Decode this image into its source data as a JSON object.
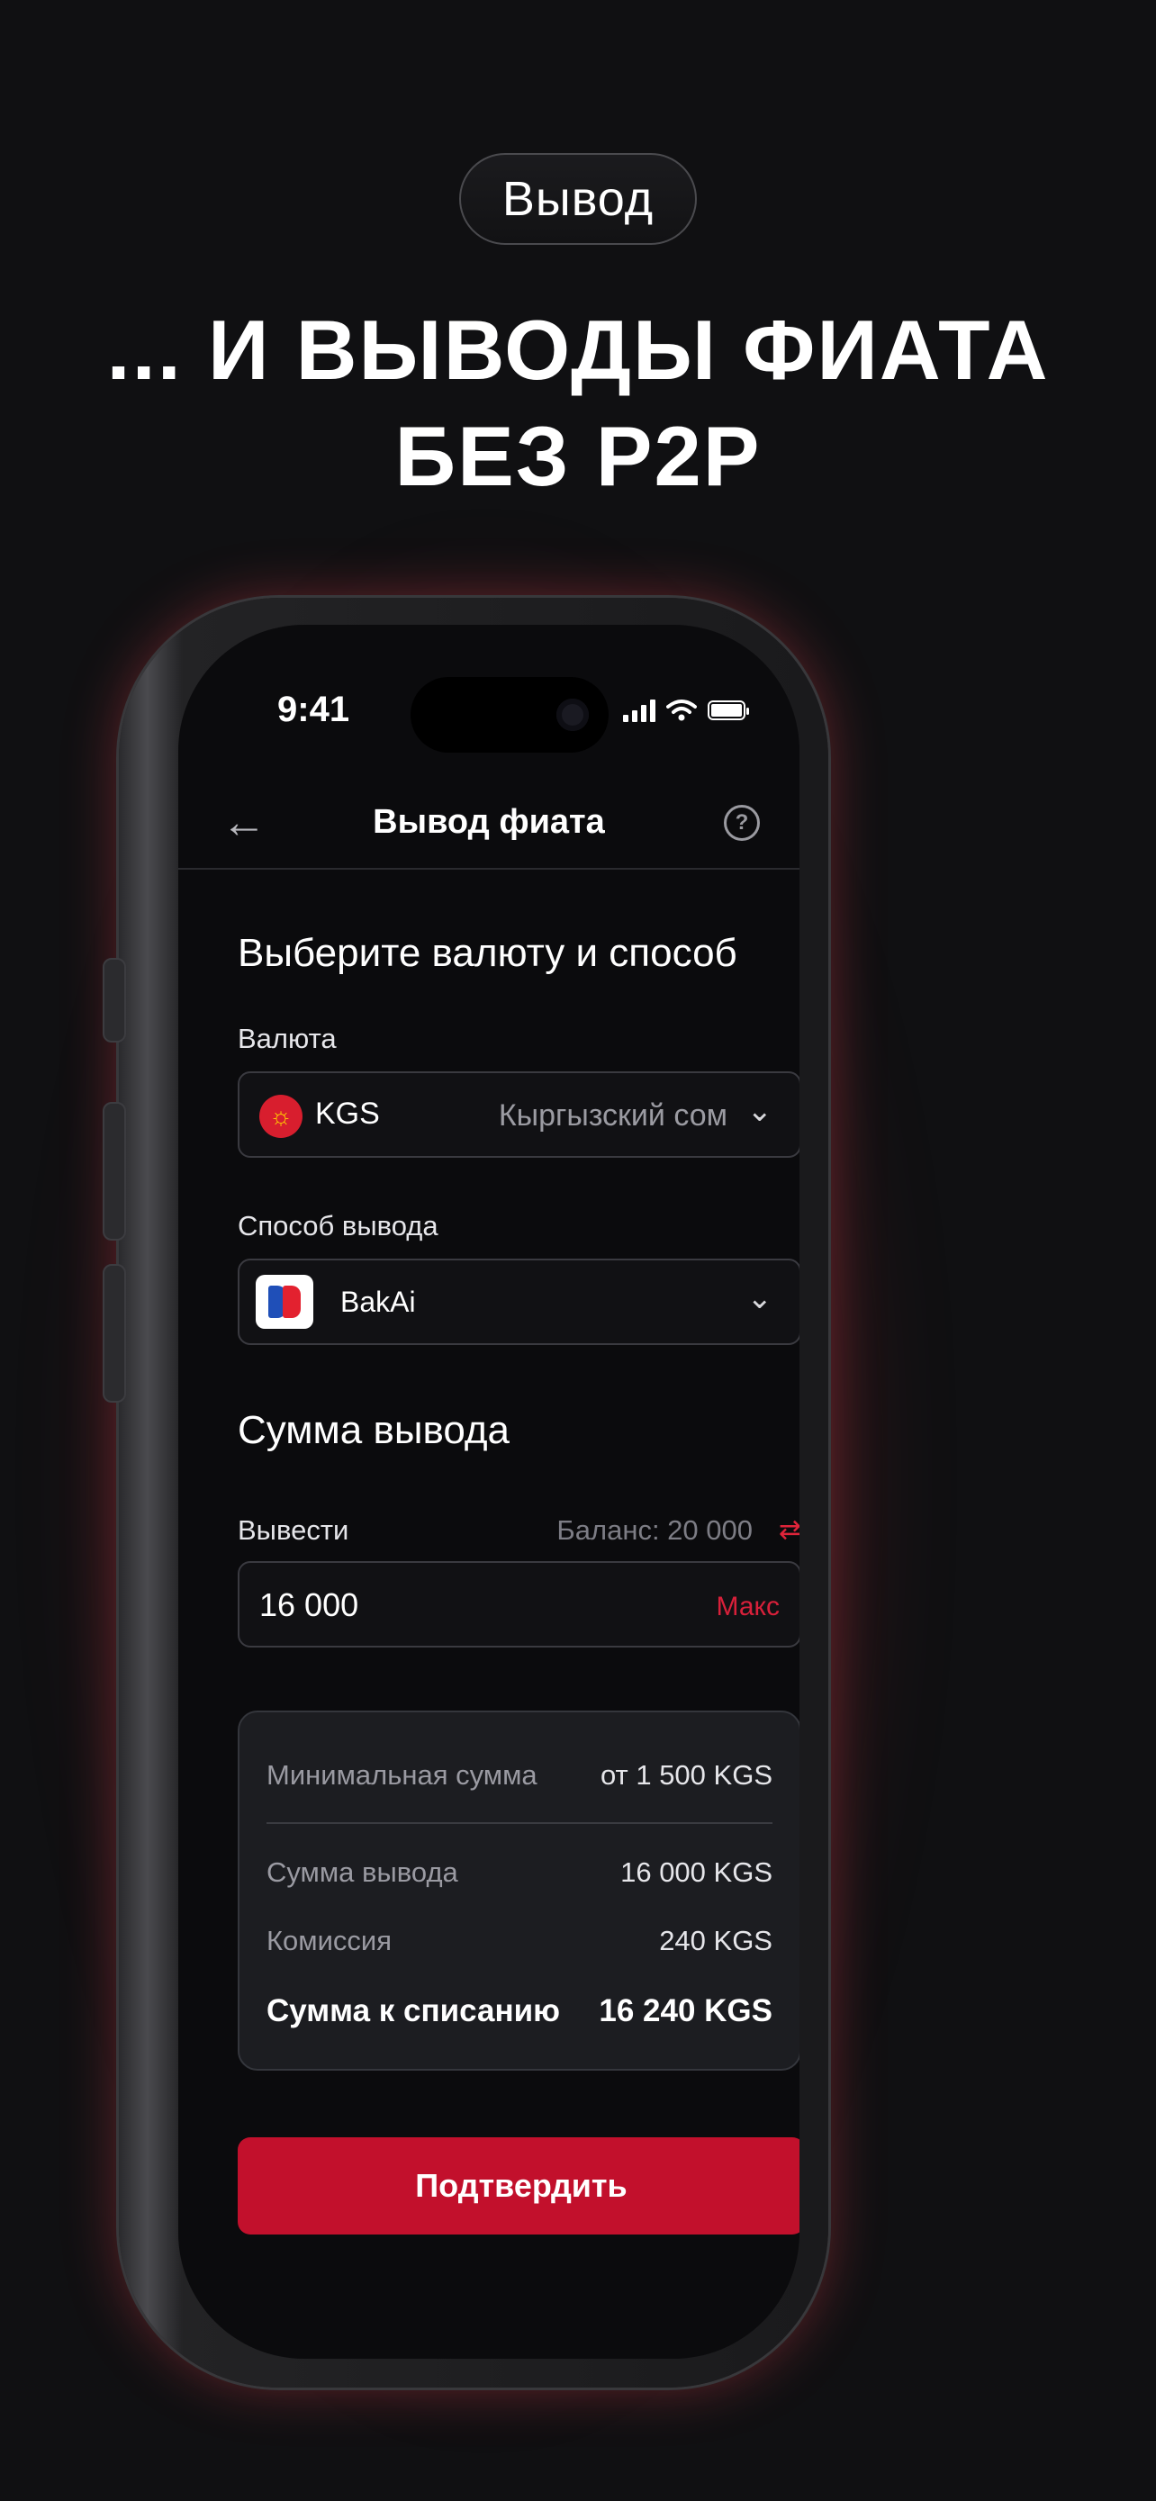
{
  "top_badge": "Вывод",
  "headline": "... И ВЫВОДЫ ФИАТА БЕЗ P2P",
  "status_bar": {
    "time": "9:41"
  },
  "nav": {
    "title": "Вывод фиата",
    "back_icon": "arrow-left-icon",
    "help_icon": "help-icon"
  },
  "section_method": {
    "title": "Выберите валюту и способ",
    "currency_label": "Валюта",
    "currency_code": "KGS",
    "currency_name": "Кыргызский сом",
    "method_label": "Способ вывода",
    "method_name": "BakAi"
  },
  "section_amount": {
    "title": "Сумма вывода",
    "withdraw_label": "Вывести",
    "balance_text": "Баланс: 20 000",
    "amount_value": "16 000",
    "max_label": "Макс"
  },
  "summary": {
    "min_label": "Минимальная сумма",
    "min_value": "от 1 500 KGS",
    "withdraw_label": "Сумма вывода",
    "withdraw_value": "16 000 KGS",
    "fee_label": "Комиссия",
    "fee_value": "240 KGS",
    "total_label": "Сумма к списанию",
    "total_value": "16 240 KGS"
  },
  "confirm_button": "Подтвердить",
  "colors": {
    "accent": "#c2102c",
    "background": "#101012",
    "card": "#1c1d21"
  }
}
